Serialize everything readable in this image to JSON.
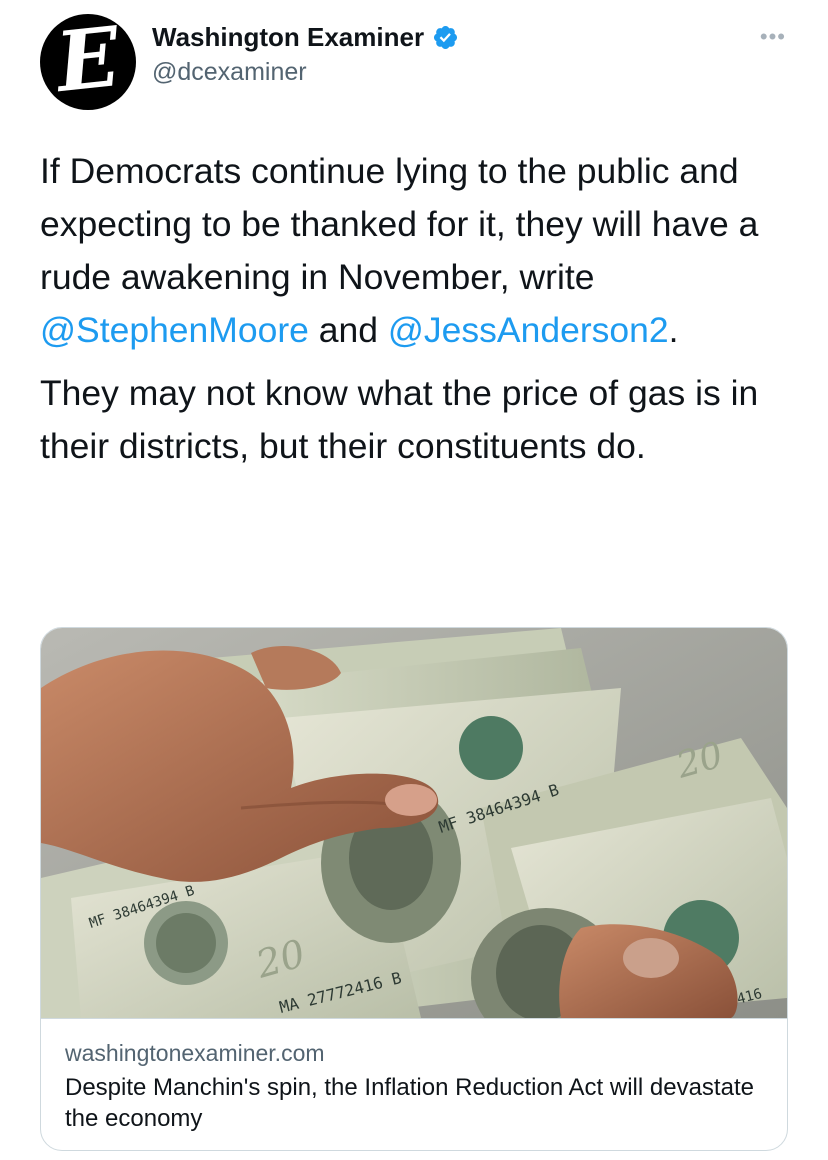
{
  "author": {
    "display_name": "Washington Examiner",
    "handle": "@dcexaminer",
    "avatar_letter": "E",
    "verified": true,
    "verified_color": "#1d9bf0"
  },
  "menu": {
    "more_label": "•••"
  },
  "tweet": {
    "para1": {
      "text_before": "If Democrats continue lying to the public and expecting to be thanked for it, they will have a rude awakening in November, write ",
      "mention1": "@StephenMoore",
      "and_text": " and ",
      "mention2": "@JessAnderson2",
      "end_text": "."
    },
    "para2": " They may not know what the price of gas is in their districts, but their constituents do."
  },
  "link_card": {
    "image_icon": "money-photo",
    "domain": "washingtonexaminer.com",
    "title": "Despite Manchin's spin, the Inflation Reduction Act will devastate the economy"
  },
  "colors": {
    "text": "#0f1419",
    "secondary": "#536471",
    "link": "#1d9bf0",
    "border": "#cfd9de"
  }
}
